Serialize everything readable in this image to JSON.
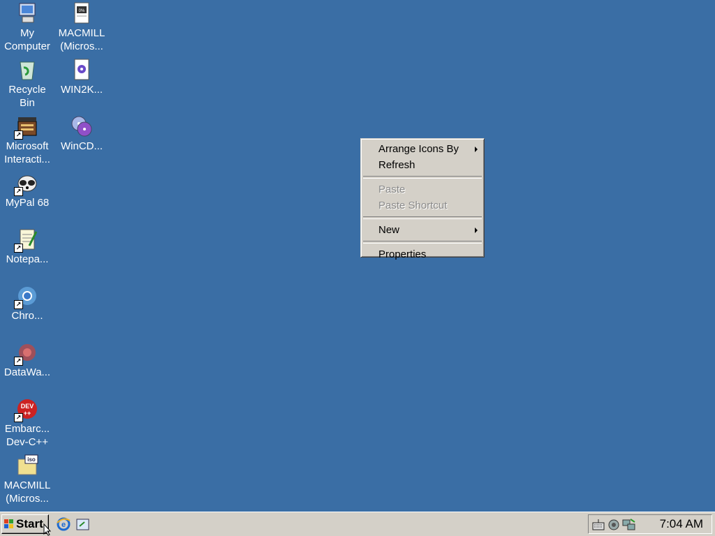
{
  "desktop": {
    "icons": [
      {
        "label": "My\nComputer"
      },
      {
        "label": "Recycle\nBin"
      },
      {
        "label": "Microsoft\nInteracti..."
      },
      {
        "label": "MyPal 68"
      },
      {
        "label": "Notepa..."
      },
      {
        "label": "Chro..."
      },
      {
        "label": "DataWa..."
      },
      {
        "label": "Embarc...\nDev-C++"
      },
      {
        "label": "MACMILL\n(Micros..."
      },
      {
        "label": "MACMILL\n(Micros..."
      },
      {
        "label": "WIN2K..."
      },
      {
        "label": "WinCD..."
      }
    ],
    "background_color": "#3a6ea5"
  },
  "context_menu": {
    "items": [
      {
        "label": "Arrange Icons By",
        "submenu": true,
        "enabled": true
      },
      {
        "label": "Refresh",
        "enabled": true
      },
      {
        "label": "Paste",
        "enabled": false
      },
      {
        "label": "Paste Shortcut",
        "enabled": false
      },
      {
        "label": "New",
        "submenu": true,
        "enabled": true
      },
      {
        "label": "Properties",
        "enabled": true
      }
    ]
  },
  "taskbar": {
    "start_label": "Start",
    "quick_launch": [
      "internet-explorer-icon",
      "show-desktop-icon"
    ],
    "tray_icons": [
      "keyboard-icon",
      "volume-icon",
      "network-icon"
    ],
    "clock": "7:04 AM"
  }
}
